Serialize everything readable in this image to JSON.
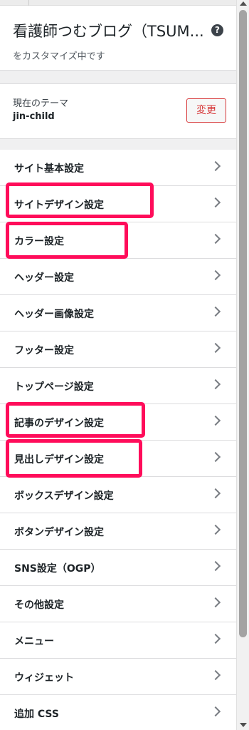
{
  "header": {
    "site_title": "看護師つむブログ（TSUM...",
    "subtitle": "をカスタマイズ中です",
    "help_icon": "help-icon"
  },
  "theme": {
    "label": "現在のテーマ",
    "name": "jin-child",
    "change_button": "変更"
  },
  "menu": [
    {
      "label": "サイト基本設定",
      "highlighted": false
    },
    {
      "label": "サイトデザイン設定",
      "highlighted": true
    },
    {
      "label": "カラー設定",
      "highlighted": true
    },
    {
      "label": "ヘッダー設定",
      "highlighted": false
    },
    {
      "label": "ヘッダー画像設定",
      "highlighted": false
    },
    {
      "label": "フッター設定",
      "highlighted": false
    },
    {
      "label": "トップページ設定",
      "highlighted": false
    },
    {
      "label": "記事のデザイン設定",
      "highlighted": true
    },
    {
      "label": "見出しデザイン設定",
      "highlighted": true
    },
    {
      "label": "ボックスデザイン設定",
      "highlighted": false
    },
    {
      "label": "ボタンデザイン設定",
      "highlighted": false
    },
    {
      "label": "SNS設定（OGP）",
      "highlighted": false
    },
    {
      "label": "その他設定",
      "highlighted": false
    },
    {
      "label": "メニュー",
      "highlighted": false
    },
    {
      "label": "ウィジェット",
      "highlighted": false
    },
    {
      "label": "追加 CSS",
      "highlighted": false
    }
  ],
  "colors": {
    "highlight": "#ff0c5a",
    "change_button": "#d63638"
  }
}
